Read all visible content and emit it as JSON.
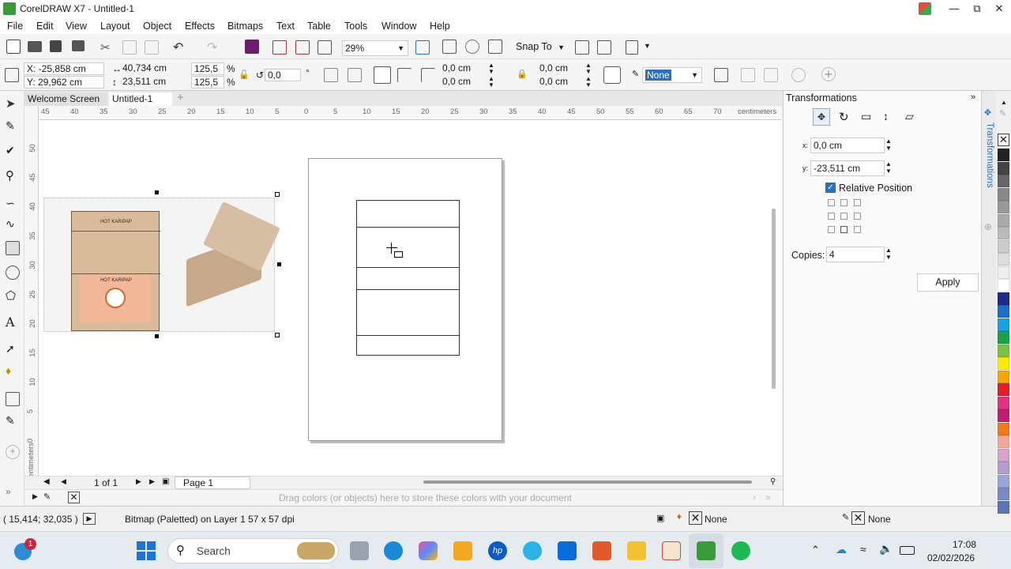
{
  "window": {
    "title": "CorelDRAW X7 - Untitled-1"
  },
  "menu": [
    "File",
    "Edit",
    "View",
    "Layout",
    "Object",
    "Effects",
    "Bitmaps",
    "Text",
    "Table",
    "Tools",
    "Window",
    "Help"
  ],
  "toolbar": {
    "zoom": "29%",
    "snap_to": "Snap To"
  },
  "property_bar": {
    "x": "X: -25,858 cm",
    "y": "Y: 29,962 cm",
    "width": "40,734 cm",
    "height": "23,511 cm",
    "scale_x": "125,5",
    "scale_y": "125,5",
    "percent": "%",
    "rotation": "0,0",
    "degree": "°",
    "pos_x1": "0,0 cm",
    "pos_y1": "0,0 cm",
    "pos_x2": "0,0 cm",
    "pos_y2": "0,0 cm",
    "outline": "None"
  },
  "doc_tabs": [
    "Welcome Screen",
    "Untitled-1"
  ],
  "ruler": {
    "h_labels": [
      "45",
      "40",
      "35",
      "30",
      "25",
      "20",
      "15",
      "10",
      "5",
      "0",
      "5",
      "10",
      "15",
      "20",
      "25",
      "30",
      "35",
      "40",
      "45",
      "50",
      "55",
      "60",
      "65",
      "70"
    ],
    "h_unit": "centimeters",
    "v_labels": [
      "50",
      "45",
      "40",
      "35",
      "30",
      "25",
      "20",
      "15",
      "10",
      "5",
      "0"
    ],
    "v_unit": "centimeters"
  },
  "page_nav": {
    "count": "1 of 1",
    "page_tab": "Page 1"
  },
  "color_dock": {
    "hint": "Drag colors (or objects) here to store these colors with your document"
  },
  "status": {
    "coords": "( 15,414; 32,035 )",
    "object_info": "Bitmap (Paletted) on Layer 1 57 x 57 dpi",
    "fill": "None",
    "outline": "None"
  },
  "docker": {
    "title": "Transformations",
    "tab_label": "Transformations",
    "x_label": "x:",
    "x_value": "0,0 cm",
    "y_label": "y:",
    "y_value": "-23,511 cm",
    "relative_position": "Relative Position",
    "copies_label": "Copies:",
    "copies_value": "4",
    "apply": "Apply"
  },
  "palette_colors": [
    "#222222",
    "#444444",
    "#666666",
    "#888888",
    "#999999",
    "#aaaaaa",
    "#bbbbbb",
    "#cccccc",
    "#dddddd",
    "#eeeeee",
    "#ffffff",
    "#1f2a8a",
    "#1e6fc8",
    "#17a2e0",
    "#1aa14a",
    "#7cc142",
    "#ffea00",
    "#f7a800",
    "#e21e26",
    "#e4327f",
    "#c01d71",
    "#ef7a1a",
    "#f3a79a",
    "#d8a3cc",
    "#b49cd0",
    "#9aa6d8",
    "#7c89c9",
    "#5f73b8"
  ],
  "taskbar": {
    "search": "Search",
    "time": "17:08",
    "date": "02/02/2026",
    "notification_badge": "1"
  },
  "artwork": {
    "label1": "HOT KARIPAP",
    "label2": "HOT KARIPAP"
  }
}
